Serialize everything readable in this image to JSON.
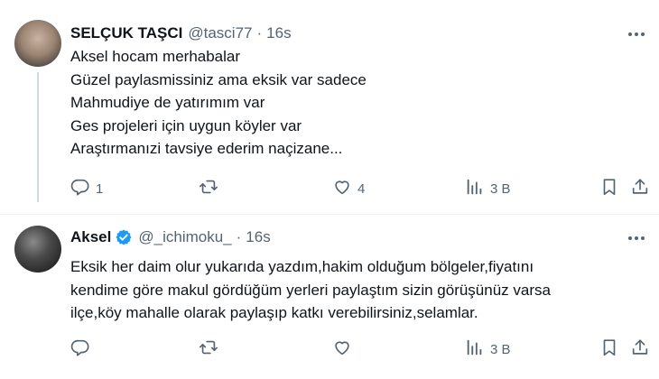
{
  "tweets": [
    {
      "display_name": "SELÇUK TAŞCI",
      "handle": "@tasci77",
      "separator": "·",
      "time": "16s",
      "verified": false,
      "lines": [
        "Aksel hocam merhabalar",
        "Güzel paylasmissiniz ama eksik var sadece",
        "Mahmudiye de yatırımım var",
        "Ges projeleri için uygun köyler var",
        "Araştırmanızi tavsiye ederim naçizane..."
      ],
      "actions": {
        "reply_count": "1",
        "retweet_count": "",
        "like_count": "4",
        "views_count": "3 B"
      }
    },
    {
      "display_name": "Aksel",
      "handle": "@_ichimoku_",
      "separator": "·",
      "time": "16s",
      "verified": true,
      "lines": [
        "Eksik her daim olur yukarıda yazdım,hakim olduğum bölgeler,fiyatını",
        "kendime göre makul gördüğüm yerleri paylaştım sizin görüşünüz varsa",
        "ilçe,köy mahalle olarak paylaşıp katkı verebilirsiniz,selamlar."
      ],
      "actions": {
        "reply_count": "",
        "retweet_count": "",
        "like_count": "",
        "views_count": "3 B"
      }
    }
  ],
  "icons": [
    "avatar",
    "verified-badge-icon",
    "more-icon",
    "reply-icon",
    "retweet-icon",
    "like-icon",
    "views-icon",
    "bookmark-icon",
    "share-icon"
  ],
  "colors": {
    "text": "#0f1419",
    "secondary": "#536471",
    "verified": "#1d9bf0",
    "divider": "#eff3f4",
    "thread_line": "#cfd9de"
  }
}
